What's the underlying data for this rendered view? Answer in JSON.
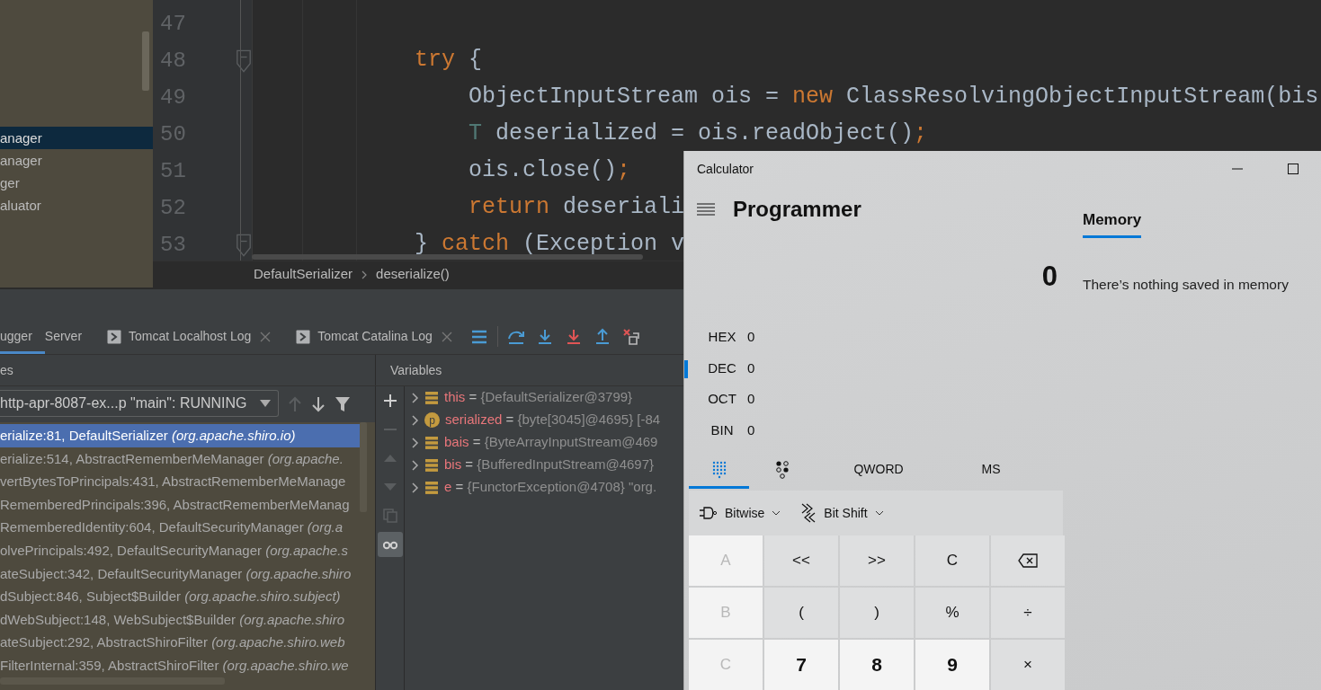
{
  "project_tree": {
    "items": [
      {
        "label": "anager",
        "selected": true
      },
      {
        "label": "anager",
        "selected": false
      },
      {
        "label": "ger",
        "selected": false
      },
      {
        "label": "aluator",
        "selected": false
      }
    ]
  },
  "editor": {
    "lines": [
      {
        "number": "47",
        "fold": false
      },
      {
        "number": "48",
        "fold": true,
        "segments": [
          {
            "text": "try",
            "kind": "keyword"
          },
          {
            "text": " {",
            "kind": "plain"
          }
        ],
        "children": [
          {
            "number": "49",
            "fold": false,
            "segments": [
              {
                "text": "ObjectInputStream ois = ",
                "kind": "plain"
              },
              {
                "text": "new",
                "kind": "keyword"
              },
              {
                "text": " ClassResolvingObjectInputStream(bis",
                "kind": "plain"
              }
            ]
          },
          {
            "number": "50",
            "fold": false,
            "segments": [
              {
                "text": "T",
                "kind": "type"
              },
              {
                "text": " deserialized = ois.readObject()",
                "kind": "plain"
              },
              {
                "text": ";",
                "kind": "keyword"
              }
            ]
          },
          {
            "number": "51",
            "fold": false,
            "segments": [
              {
                "text": "ois.close()",
                "kind": "plain"
              },
              {
                "text": ";",
                "kind": "keyword"
              }
            ]
          },
          {
            "number": "52",
            "fold": false,
            "segments": [
              {
                "text": "return",
                "kind": "keyword"
              },
              {
                "text": " deseriali",
                "kind": "plain"
              }
            ]
          }
        ]
      },
      {
        "number": "53",
        "fold": true,
        "segments": [
          {
            "text": "} ",
            "kind": "plain"
          },
          {
            "text": "catch",
            "kind": "keyword"
          },
          {
            "text": " (Exception v",
            "kind": "plain"
          }
        ]
      }
    ],
    "breadcrumb": [
      "DefaultSerializer",
      "deserialize()"
    ]
  },
  "debug_tabs": [
    {
      "label": "ugger",
      "selected": true,
      "kind": "plain",
      "closable": false
    },
    {
      "label": "Server",
      "selected": false,
      "kind": "plain",
      "closable": false
    },
    {
      "label": "Tomcat Localhost Log",
      "selected": false,
      "kind": "console",
      "closable": true
    },
    {
      "label": "Tomcat Catalina Log",
      "selected": false,
      "kind": "console",
      "closable": true
    }
  ],
  "debug_toolbar": [
    {
      "kind": "layout"
    },
    {
      "kind": "step-over"
    },
    {
      "kind": "step-into"
    },
    {
      "kind": "force-step-into"
    },
    {
      "kind": "step-out"
    },
    {
      "kind": "drop-frame"
    }
  ],
  "frames": {
    "header": "es",
    "thread": "http-apr-8087-ex...p \"main\": RUNNING",
    "rows": [
      {
        "method": "erialize:81, DefaultSerializer",
        "package": "(org.apache.shiro.io)",
        "selected": true
      },
      {
        "method": "erialize:514, AbstractRememberMeManager",
        "package": "(org.apache.",
        "selected": false
      },
      {
        "method": "vertBytesToPrincipals:431, AbstractRememberMeManage",
        "selected": false
      },
      {
        "method": "RememberedPrincipals:396, AbstractRememberMeManag",
        "selected": false
      },
      {
        "method": "RememberedIdentity:604, DefaultSecurityManager",
        "package": "(org.a",
        "selected": false
      },
      {
        "method": "olvePrincipals:492, DefaultSecurityManager",
        "package": "(org.apache.s",
        "selected": false
      },
      {
        "method": "ateSubject:342, DefaultSecurityManager",
        "package": "(org.apache.shiro",
        "selected": false
      },
      {
        "method": "dSubject:846, Subject$Builder",
        "package": "(org.apache.shiro.subject)",
        "selected": false
      },
      {
        "method": "dWebSubject:148, WebSubject$Builder",
        "package": "(org.apache.shiro",
        "selected": false
      },
      {
        "method": "ateSubject:292, AbstractShiroFilter",
        "package": "(org.apache.shiro.web",
        "selected": false
      },
      {
        "method": "FilterInternal:359, AbstractShiroFilter",
        "package": "(org.apache.shiro.we",
        "selected": false
      }
    ]
  },
  "variables": {
    "header": "Variables",
    "tools": [
      {
        "kind": "add",
        "disabled": false
      },
      {
        "kind": "remove",
        "disabled": true
      },
      {
        "kind": "up",
        "disabled": true
      },
      {
        "kind": "down",
        "disabled": true
      },
      {
        "kind": "copy",
        "disabled": true
      },
      {
        "kind": "watches",
        "disabled": false
      }
    ],
    "rows": [
      {
        "kind": "field",
        "name": "this",
        "eq": "=",
        "value": "{DefaultSerializer@3799}"
      },
      {
        "kind": "param",
        "badge": "p",
        "name": "serialized",
        "eq": "=",
        "value": "{byte[3045]@4695} [-84"
      },
      {
        "kind": "field",
        "name": "bais",
        "eq": "=",
        "value": "{ByteArrayInputStream@469"
      },
      {
        "kind": "field",
        "name": "bis",
        "eq": "=",
        "value": "{BufferedInputStream@4697}"
      },
      {
        "kind": "field",
        "name": "e",
        "eq": "=",
        "value": "{FunctorException@4708} \"org."
      }
    ]
  },
  "calculator": {
    "title": "Calculator",
    "mode": "Programmer",
    "memory_tab": {
      "label": "Memory",
      "selected": true
    },
    "display": "0",
    "memory_message": "There’s nothing saved in memory",
    "radix": [
      {
        "label": "HEX",
        "value": "0",
        "selected": false
      },
      {
        "label": "DEC",
        "value": "0",
        "selected": true
      },
      {
        "label": "OCT",
        "value": "0",
        "selected": false
      },
      {
        "label": "BIN",
        "value": "0",
        "selected": false
      }
    ],
    "keypad_tabs": [
      {
        "kind": "keypad",
        "selected": true
      },
      {
        "kind": "bits",
        "selected": false
      },
      {
        "kind": "text",
        "label": "QWORD",
        "selected": false
      },
      {
        "kind": "text",
        "label": "MS",
        "selected": false
      }
    ],
    "operators": [
      {
        "kind": "bitwise",
        "label": "Bitwise"
      },
      {
        "kind": "shift",
        "label": "Bit Shift"
      }
    ],
    "keys": [
      {
        "label": "A",
        "kind": "letter",
        "disabled": true
      },
      {
        "label": "<<",
        "kind": "op",
        "disabled": false
      },
      {
        "label": ">>",
        "kind": "op",
        "disabled": false
      },
      {
        "label": "C",
        "kind": "op",
        "disabled": false
      },
      {
        "kind": "backspace",
        "disabled": false
      },
      {
        "label": "B",
        "kind": "letter",
        "disabled": true
      },
      {
        "label": "(",
        "kind": "op",
        "disabled": false
      },
      {
        "label": ")",
        "kind": "op",
        "disabled": false
      },
      {
        "label": "%",
        "kind": "op",
        "disabled": false
      },
      {
        "label": "÷",
        "kind": "op",
        "disabled": false
      },
      {
        "label": "C",
        "kind": "letter",
        "disabled": true
      },
      {
        "label": "7",
        "kind": "digit",
        "disabled": false
      },
      {
        "label": "8",
        "kind": "digit",
        "disabled": false
      },
      {
        "label": "9",
        "kind": "digit",
        "disabled": false
      },
      {
        "label": "×",
        "kind": "op",
        "disabled": false
      }
    ]
  }
}
